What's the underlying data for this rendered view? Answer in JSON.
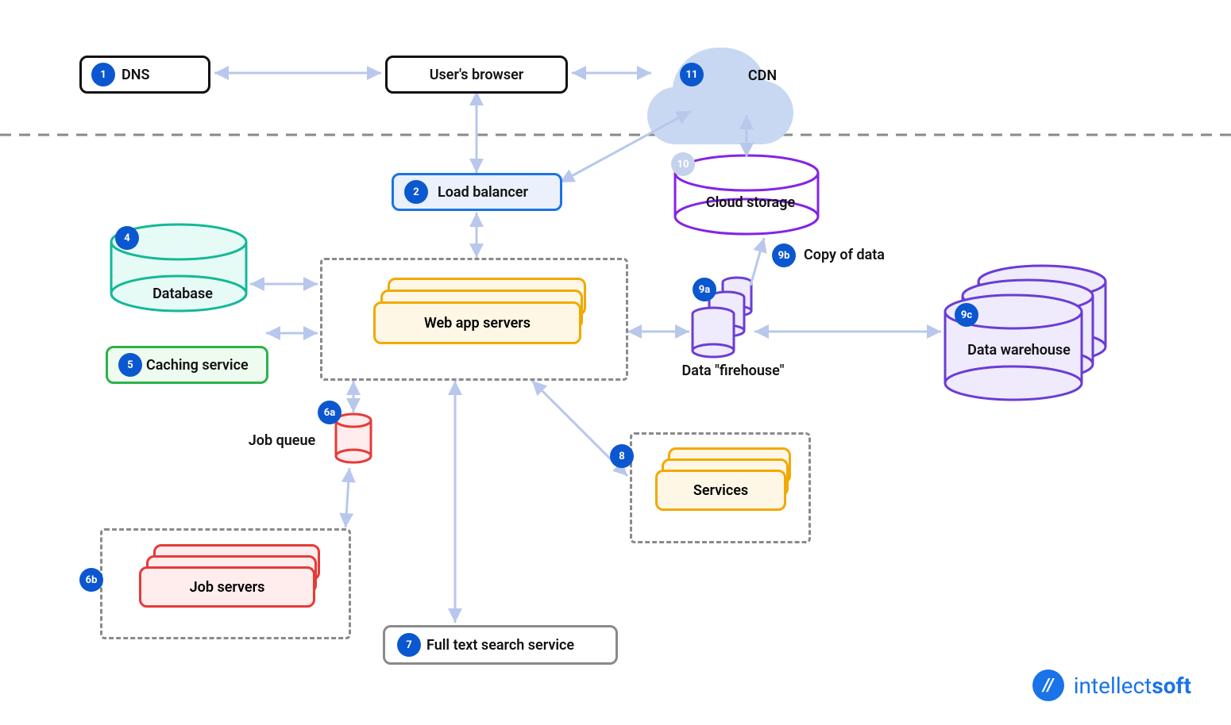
{
  "badges": {
    "b1": "1",
    "b2": "2",
    "b4": "4",
    "b5": "5",
    "b6a": "6a",
    "b6b": "6b",
    "b7": "7",
    "b8": "8",
    "b9a": "9a",
    "b9b": "9b",
    "b9c": "9c",
    "b10": "10",
    "b11": "11"
  },
  "nodes": {
    "dns": "DNS",
    "browser": "User's browser",
    "cdn": "CDN",
    "load_balancer": "Load balancer",
    "database": "Database",
    "caching": "Caching service",
    "web_app": "Web app servers",
    "job_queue": "Job queue",
    "job_servers": "Job servers",
    "full_text": "Full text search service",
    "services": "Services",
    "copy_of_data": "Copy of data",
    "cloud_storage": "Cloud storage",
    "firehose": "Data \"firehouse\"",
    "warehouse": "Data warehouse"
  },
  "logo": {
    "brand": "intellect",
    "suffix": "soft"
  }
}
